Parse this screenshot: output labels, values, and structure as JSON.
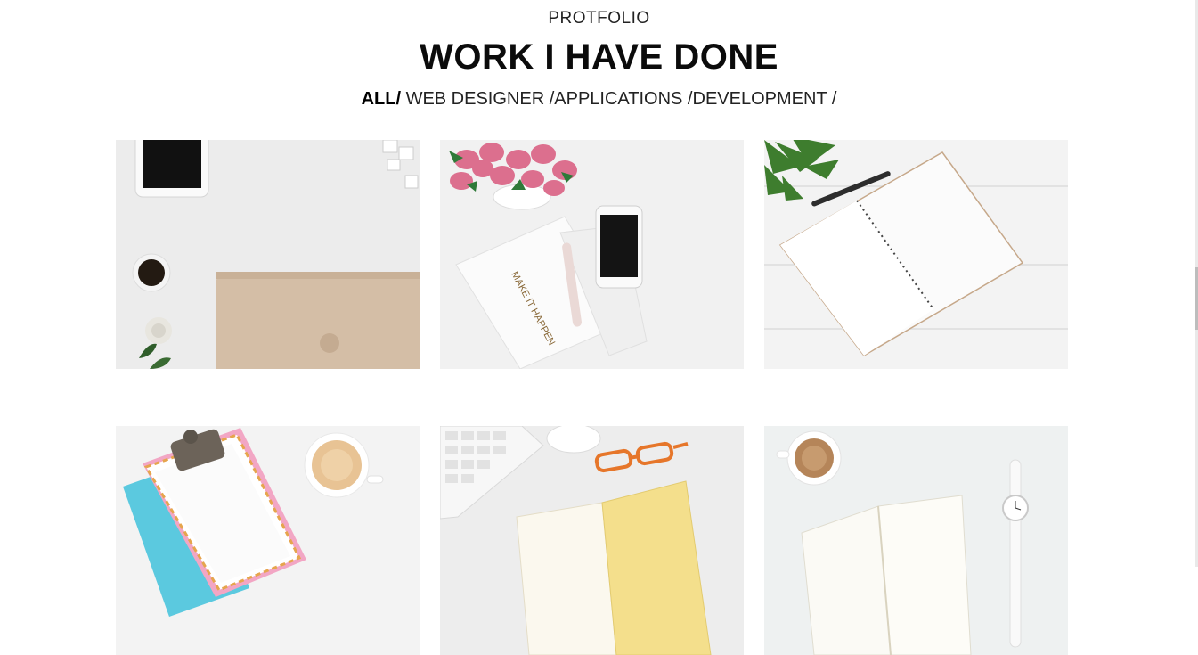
{
  "header": {
    "eyebrow": "PROTFOLIO",
    "title": "WORK I HAVE DONE"
  },
  "filters": [
    {
      "label": "ALL/",
      "active": true
    },
    {
      "label": " WEB DESIGNER /",
      "active": false
    },
    {
      "label": "APPLICATIONS /",
      "active": false
    },
    {
      "label": "DEVELOPMENT /",
      "active": false
    }
  ],
  "portfolio": {
    "items": [
      {
        "icon": "desk-laptop-tablet-coffee-image"
      },
      {
        "icon": "desk-tulips-phone-notebook-image",
        "notebook_text": "MAKE IT HAPPEN"
      },
      {
        "icon": "desk-spiral-notebook-plant-image"
      },
      {
        "icon": "desk-clipboard-coffee-image"
      },
      {
        "icon": "desk-keyboard-glasses-notebook-image"
      },
      {
        "icon": "desk-coffee-watch-notebook-image"
      }
    ]
  },
  "colors": {
    "background": "#ffffff",
    "text": "#111111"
  }
}
